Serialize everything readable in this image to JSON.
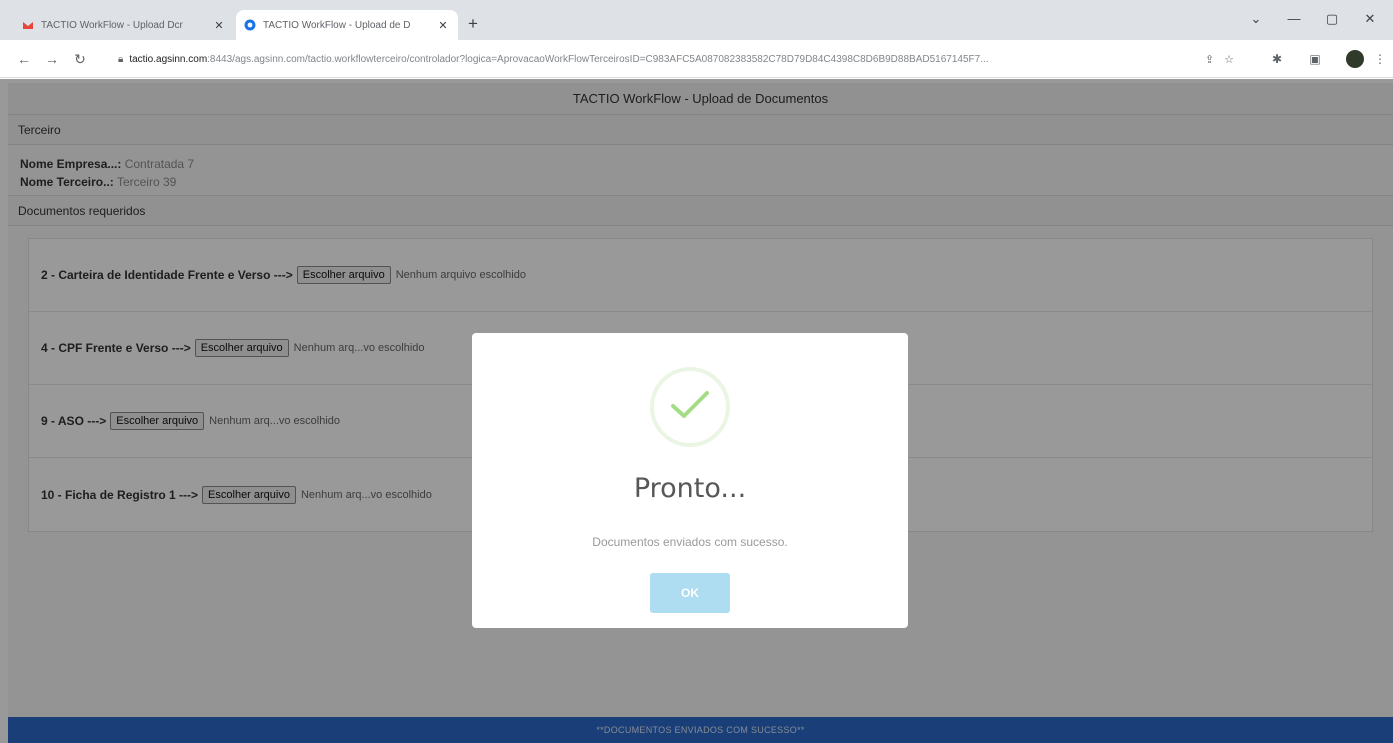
{
  "browser": {
    "tabs": [
      {
        "title": "TACTIO WorkFlow - Upload Dcr",
        "favicon_color": "#e8453c"
      },
      {
        "title": "TACTIO WorkFlow - Upload de D",
        "favicon_color": "#1a73e8"
      }
    ],
    "new_tab": "+",
    "window_controls": {
      "minimize": "—",
      "maximize": "▢",
      "close": "✕",
      "tab_search": "⌄"
    },
    "address": {
      "host": "tactio.agsinn.com",
      "rest": ":8443/ags.agsinn.com/tactio.workflowterceiro/controlador?logica=AprovacaoWorkFlowTerceirosID=C983AFC5A087082383582C78D79D84C4398C8D6B9D88BAD5167145F7..."
    },
    "icons": [
      "back-arrow",
      "forward-arrow",
      "reload",
      "lock",
      "share",
      "star",
      "extensions",
      "sidebar",
      "profile"
    ]
  },
  "page": {
    "title": "TACTIO WorkFlow - Upload de Documentos",
    "section_terceiro": "Terceiro",
    "empresa_label": "Nome Empresa...:",
    "empresa_value": "Contratada 7",
    "terceiro_label": "Nome Terceiro..:",
    "terceiro_value": "Terceiro 39",
    "section_docs": "Documentos requeridos",
    "documents": [
      {
        "label": "2 - Carteira de Identidade Frente e Verso --->",
        "button": "Escolher arquivo",
        "status": "Nenhum arquivo escolhido"
      },
      {
        "label": "4 - CPF Frente e Verso --->",
        "button": "Escolher arquivo",
        "status": "Nenhum arq...vo escolhido"
      },
      {
        "label": "9 - ASO --->",
        "button": "Escolher arquivo",
        "status": "Nenhum arq...vo escolhido"
      },
      {
        "label": "10 - Ficha de Registro 1 --->",
        "button": "Escolher arquivo",
        "status": "Nenhum arq...vo escolhido"
      }
    ],
    "footer": "**DOCUMENTOS ENVIADOS COM SUCESSO**"
  },
  "modal": {
    "icon": "success-check",
    "title": "Pronto...",
    "text": "Documentos enviados com sucesso.",
    "ok_label": "OK",
    "check_color": "#a5dc86",
    "ok_color": "#aedcf0"
  }
}
